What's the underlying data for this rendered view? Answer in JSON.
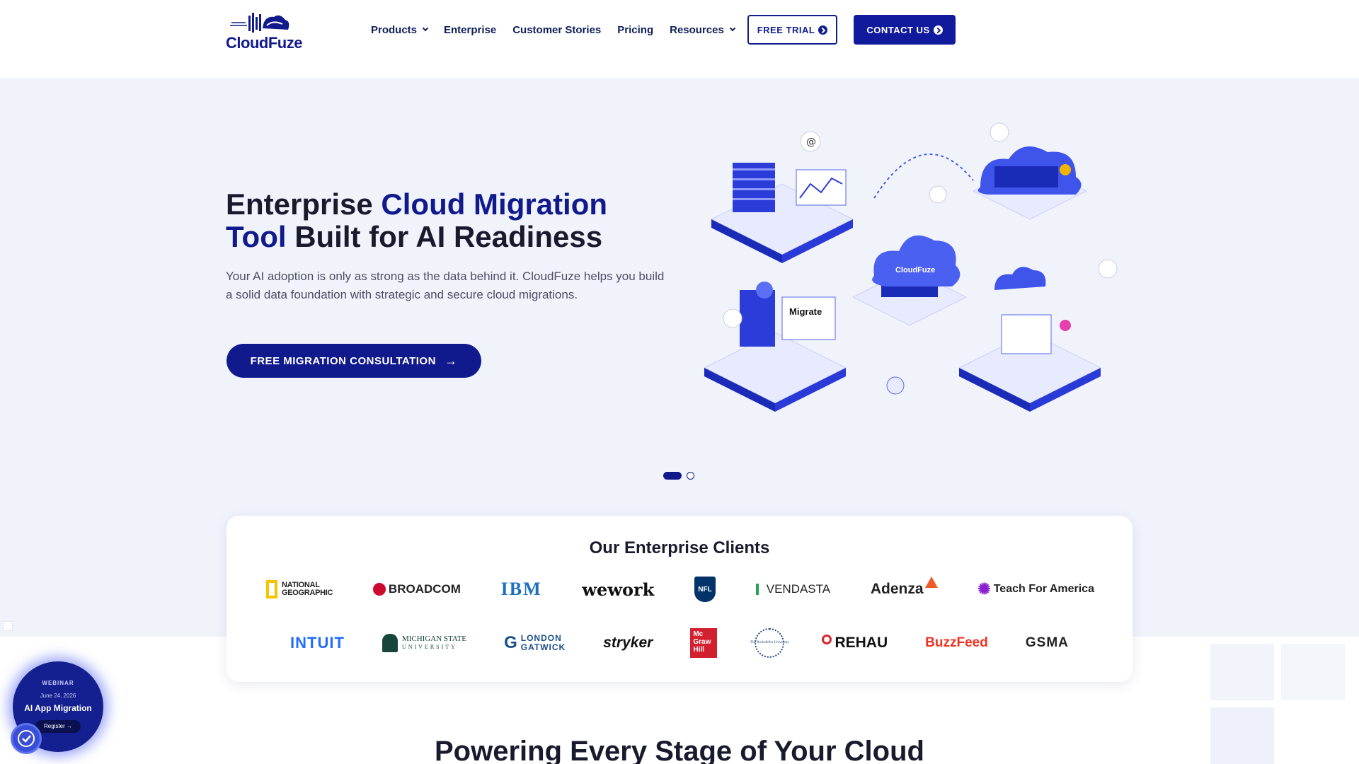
{
  "header": {
    "logo_text": "CloudFuze",
    "nav": [
      {
        "label": "Products",
        "dropdown": true
      },
      {
        "label": "Enterprise",
        "dropdown": false
      },
      {
        "label": "Customer Stories",
        "dropdown": false
      },
      {
        "label": "Pricing",
        "dropdown": false
      },
      {
        "label": "Resources",
        "dropdown": true
      }
    ],
    "free_trial": "FREE TRIAL",
    "contact_us": "CONTACT US"
  },
  "hero": {
    "title_part1": "Enterprise ",
    "title_accent1": "Cloud Migration",
    "title_accent2": "Tool",
    "title_part2": " Built for AI Readiness",
    "description": "Your AI adoption is only as strong as the data behind it. CloudFuze helps you build a solid data foundation with strategic and secure cloud migrations.",
    "cta": "FREE MIGRATION CONSULTATION",
    "illustration": {
      "cloud_label": "CloudFuze",
      "migrate_label": "Migrate"
    },
    "slides": {
      "count": 2,
      "active": 1
    }
  },
  "clients": {
    "title": "Our Enterprise Clients",
    "row1": [
      {
        "name": "NATIONAL GEOGRAPHIC",
        "line1": "NATIONAL",
        "line2": "GEOGRAPHIC"
      },
      {
        "name": "BROADCOM"
      },
      {
        "name": "IBM"
      },
      {
        "name": "wework"
      },
      {
        "name": "NFL"
      },
      {
        "name": "VENDASTA"
      },
      {
        "name": "Adenza"
      },
      {
        "name": "Teach For America"
      }
    ],
    "row2": [
      {
        "name": "INTUIT"
      },
      {
        "name": "MICHIGAN STATE",
        "line1": "MICHIGAN STATE",
        "line2": "UNIVERSITY"
      },
      {
        "name": "LONDON GATWICK",
        "line1": "LONDON",
        "line2": "GATWICK"
      },
      {
        "name": "stryker"
      },
      {
        "name": "Mc Graw Hill",
        "line1": "Mc",
        "line2": "Graw",
        "line3": "Hill"
      },
      {
        "name": "The Rockefeller University"
      },
      {
        "name": "REHAU"
      },
      {
        "name": "BuzzFeed"
      },
      {
        "name": "GSMA"
      }
    ]
  },
  "next_section": {
    "title": "Powering Every Stage of Your Cloud"
  },
  "webinar": {
    "tag": "WEBINAR",
    "date": "June 24, 2026",
    "title": "AI App Migration",
    "register": "Register →"
  },
  "colors": {
    "brand": "#111a8c",
    "hero_bg": "#f1f3fb",
    "text_dark": "#1a1a2e"
  }
}
